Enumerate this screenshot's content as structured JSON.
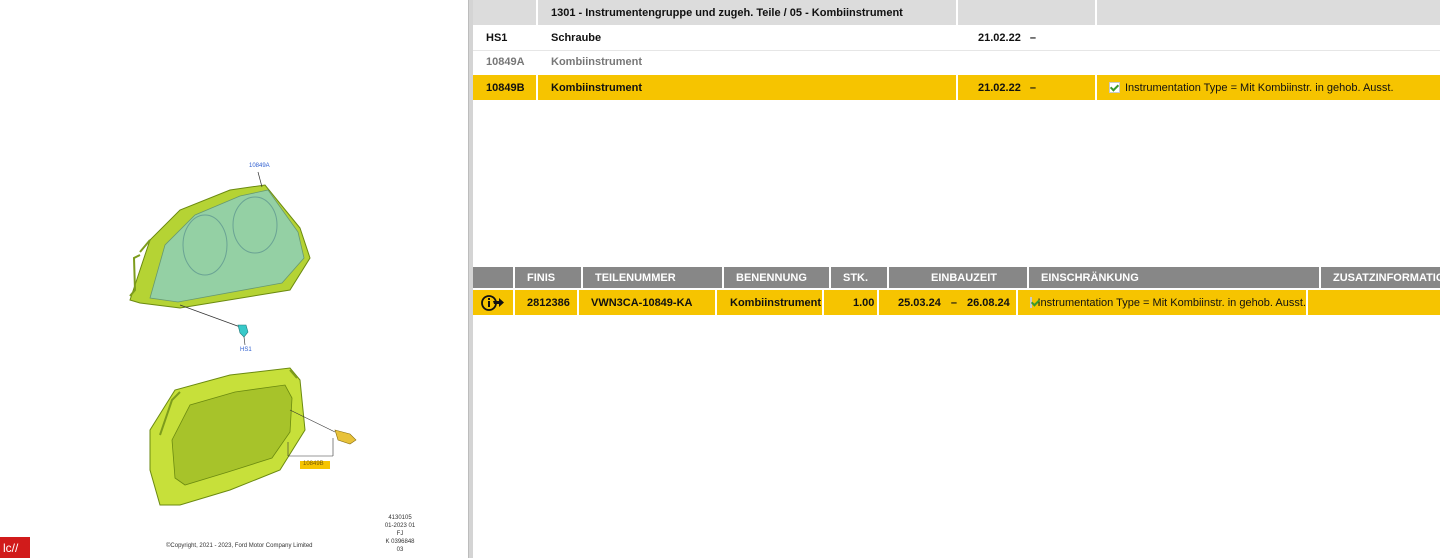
{
  "diagram": {
    "callout_top": "10849A",
    "callout_screw": "HS1",
    "callout_bottom": "10849B",
    "ref_lines": [
      "4130105",
      "01-2023 01",
      "FJ",
      "K 0396848 03"
    ],
    "copyright": "©Copyright, 2021 - 2023, Ford Motor Company Limited",
    "badge": "lc//"
  },
  "top_table": {
    "title": "1301 - Instrumentengruppe und zugeh. Teile / 05 - Kombiinstrument",
    "rows": [
      {
        "code": "HS1",
        "name": "Schraube",
        "date": "21.02.22",
        "dash": "–",
        "restriction": ""
      },
      {
        "code": "10849A",
        "name": "Kombiinstrument",
        "date": "",
        "dash": "",
        "restriction": ""
      },
      {
        "code": "10849B",
        "name": "Kombiinstrument",
        "date": "21.02.22",
        "dash": "–",
        "restriction": "Instrumentation Type = Mit Kombiinstr. in gehob. Ausst."
      }
    ]
  },
  "parts_table": {
    "headers": [
      "FINIS",
      "TEILENUMMER",
      "BENENNUNG",
      "STK.",
      "EINBAUZEIT",
      "EINSCHRÄNKUNG",
      "ZUSATZINFORMATION"
    ],
    "row": {
      "finis": "2812386",
      "part_number": "VWN3CA-10849-KA",
      "name": "Kombiinstrument",
      "qty": "1.00",
      "from": "25.03.24",
      "dash": "–",
      "to": "26.08.24",
      "restriction": "Instrumentation Type = Mit Kombiinstr. in gehob. Ausst."
    }
  },
  "colors": {
    "highlight": "#f6c400",
    "header_dark": "#878787",
    "header_light": "#dcdcdc",
    "part_green": "#b5d334"
  }
}
